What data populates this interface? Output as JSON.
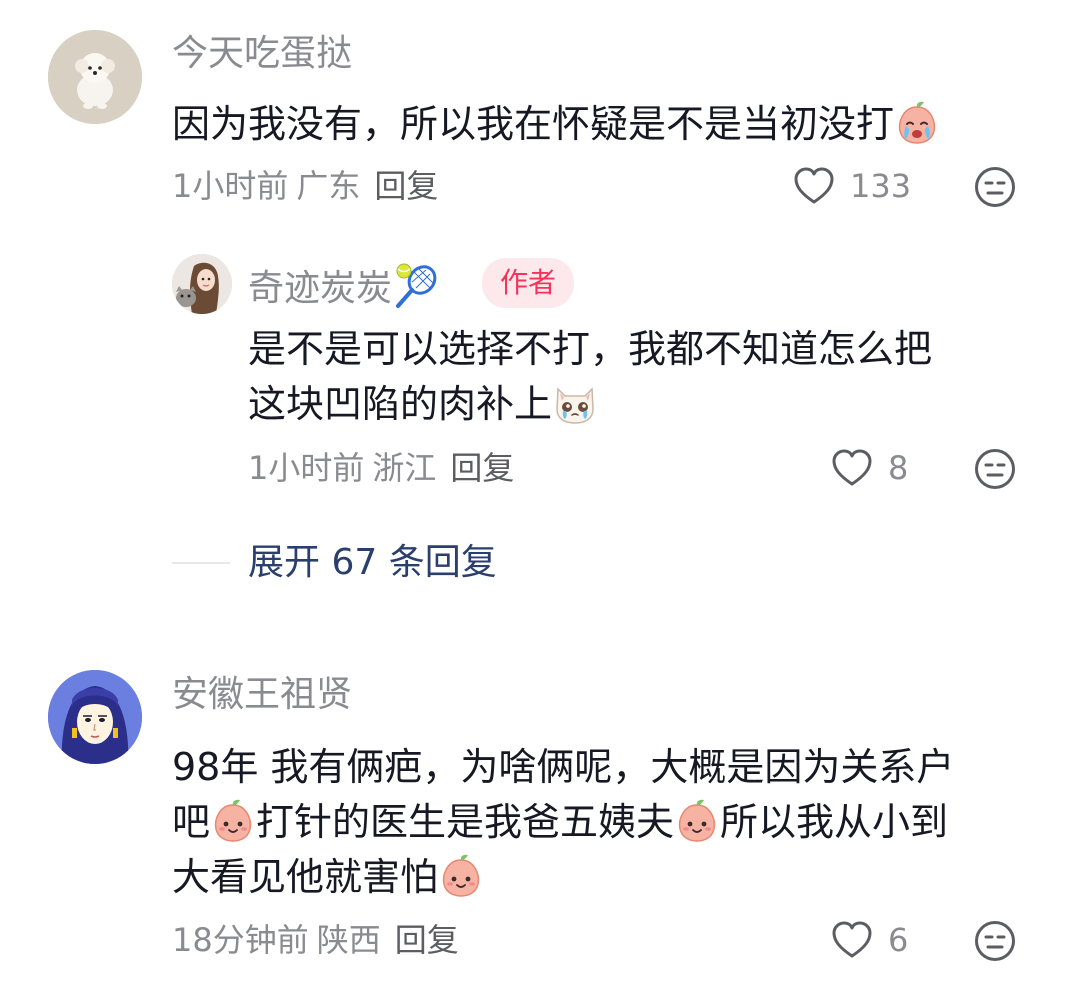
{
  "comments": [
    {
      "username": "今天吃蛋挞",
      "text_lines": [
        "因为我没有，所以我在怀疑是不是当初没打"
      ],
      "time": "1小时前",
      "location": "广东",
      "reply_label": "回复",
      "likes": "133",
      "avatar_icon": "white-puppy-avatar",
      "emoji_icon": "crying-peach-emoji",
      "replies": [
        {
          "username": "奇迹炭炭",
          "username_icon": "tennis-racket-icon",
          "badge": "作者",
          "text_lines": [
            "是不是可以选择不打，我都不知道怎么把",
            "这块凹陷的肉补上"
          ],
          "time": "1小时前",
          "location": "浙江",
          "reply_label": "回复",
          "likes": "8",
          "emoji_icon": "crying-cat-emoji"
        }
      ],
      "expand_label": "展开 67 条回复"
    },
    {
      "username": "安徽王祖贤",
      "text_lines": [
        "98年 我有俩疤，为啥俩呢，大概是因为关系户",
        "吧",
        "打针的医生是我爸五姨夫",
        "所以我从小到",
        "大看见他就害怕"
      ],
      "time": "18分钟前",
      "location": "陕西",
      "reply_label": "回复",
      "likes": "6",
      "avatar_icon": "anime-girl-avatar",
      "emoji_icon": "smiling-peach-emoji"
    }
  ],
  "colors": {
    "meta_gray": "#8a8b91",
    "text_dark": "#161823",
    "author_badge_bg": "#fde9ec",
    "author_badge_text": "#f4335a",
    "expand_link": "#2a3f6e"
  }
}
